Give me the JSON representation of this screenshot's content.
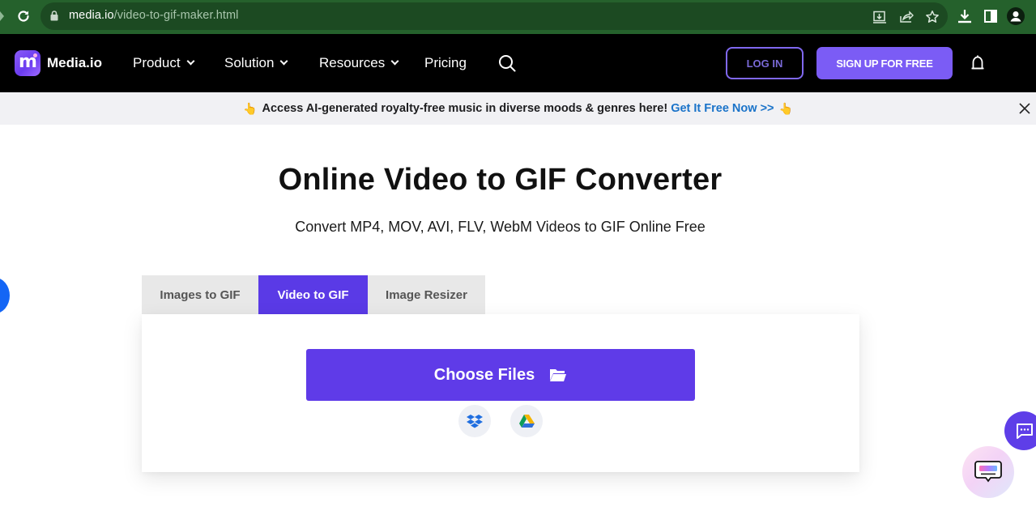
{
  "browser": {
    "url_host": "media.io",
    "url_path": "/video-to-gif-maker.html",
    "omnibox_icons": [
      "install-app-icon",
      "share-icon",
      "bookmark-star-icon"
    ],
    "toolbar_icons": [
      "download-icon",
      "side-panel-icon",
      "profile-icon"
    ]
  },
  "nav": {
    "brand": "Media.io",
    "items": [
      {
        "label": "Product",
        "has_dropdown": true
      },
      {
        "label": "Solution",
        "has_dropdown": true
      },
      {
        "label": "Resources",
        "has_dropdown": true
      },
      {
        "label": "Pricing",
        "has_dropdown": false
      }
    ],
    "login_label": "LOG IN",
    "signup_label": "SIGN UP FOR FREE"
  },
  "announcement": {
    "text": "Access AI-generated royalty-free music in diverse moods & genres here!",
    "link": "Get It Free Now >>",
    "hand_glyph": "👆"
  },
  "hero": {
    "title": "Online Video to GIF Converter",
    "subtitle": "Convert MP4, MOV, AVI, FLV, WebM Videos to GIF Online Free"
  },
  "tabs": [
    {
      "label": "Images to GIF",
      "active": false
    },
    {
      "label": "Video to GIF",
      "active": true
    },
    {
      "label": "Image Resizer",
      "active": false
    }
  ],
  "upload": {
    "choose_label": "Choose Files",
    "cloud_sources": [
      "dropbox",
      "google-drive"
    ]
  },
  "colors": {
    "brand_purple": "#5f3be8",
    "signup_purple": "#7b5cf5",
    "link_blue": "#1a73c9",
    "chrome_green": "#25612c"
  }
}
